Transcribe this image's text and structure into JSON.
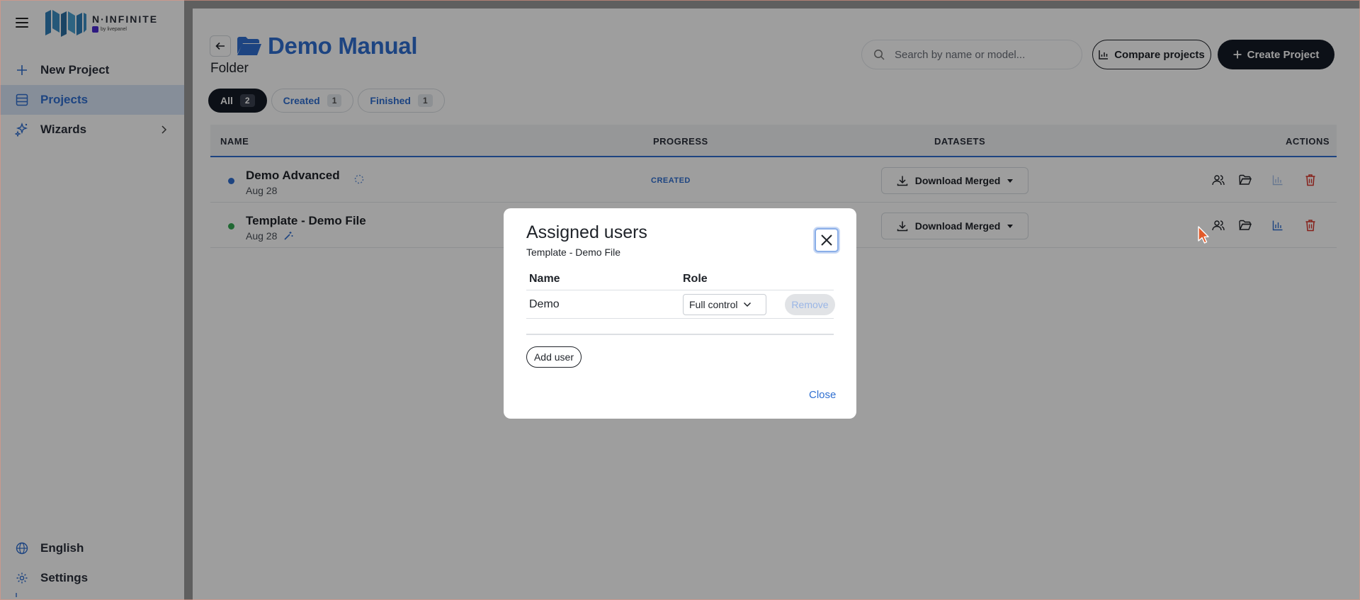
{
  "sidebar": {
    "brand": {
      "name": "N·INFINITE",
      "sub": "by livepanel"
    },
    "items": [
      {
        "label": "New Project",
        "icon": "plus-icon",
        "active": false
      },
      {
        "label": "Projects",
        "icon": "list-icon",
        "active": true
      },
      {
        "label": "Wizards",
        "icon": "sparkles-icon",
        "active": false
      }
    ],
    "bottom": [
      {
        "label": "English",
        "icon": "globe-icon"
      },
      {
        "label": "Settings",
        "icon": "gear-icon"
      }
    ]
  },
  "header": {
    "title": "Demo Manual",
    "subtitle": "Folder",
    "search_placeholder": "Search by name or model...",
    "compare_label": "Compare projects",
    "create_label": "Create Project"
  },
  "tabs": [
    {
      "label": "All",
      "count": "2",
      "active": true
    },
    {
      "label": "Created",
      "count": "1",
      "active": false
    },
    {
      "label": "Finished",
      "count": "1",
      "active": false
    }
  ],
  "table": {
    "columns": {
      "name": "NAME",
      "progress": "PROGRESS",
      "datasets": "DATASETS",
      "actions": "ACTIONS"
    },
    "rows": [
      {
        "name": "Demo Advanced",
        "date": "Aug 28",
        "status": "CREATED",
        "dot_color": "#2f6fd1",
        "download_label": "Download Merged"
      },
      {
        "name": "Template - Demo File",
        "date": "Aug 28",
        "status": "",
        "dot_color": "#34a853",
        "download_label": "Download Merged"
      }
    ]
  },
  "modal": {
    "title": "Assigned users",
    "subtitle": "Template - Demo File",
    "col_name": "Name",
    "col_role": "Role",
    "users": [
      {
        "name": "Demo",
        "role": "Full control",
        "remove_label": "Remove"
      }
    ],
    "add_user_label": "Add user",
    "close_label": "Close"
  },
  "colors": {
    "accent": "#2f6fd1",
    "dark": "#141a26",
    "danger": "#d9342b"
  }
}
